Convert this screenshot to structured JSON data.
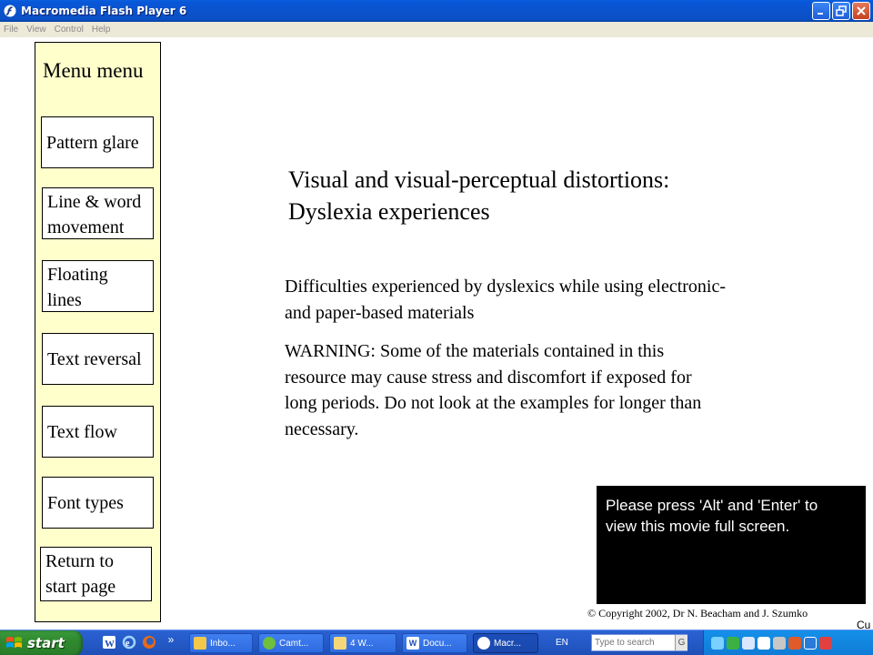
{
  "window": {
    "title": "Macromedia Flash Player 6"
  },
  "menubar": {
    "items": [
      "File",
      "View",
      "Control",
      "Help"
    ]
  },
  "sidebar": {
    "title": "Menu menu",
    "buttons": [
      {
        "line1": "Pattern glare",
        "line2": ""
      },
      {
        "line1": "Line & word",
        "line2": "movement"
      },
      {
        "line1": "Floating",
        "line2": "lines"
      },
      {
        "line1": "Text reversal",
        "line2": ""
      },
      {
        "line1": "Text flow",
        "line2": ""
      },
      {
        "line1": "Font types",
        "line2": ""
      },
      {
        "line1": "Return to",
        "line2": "start page"
      }
    ]
  },
  "main": {
    "heading_line1": "Visual and visual-perceptual distortions:",
    "heading_line2": "Dyslexia experiences",
    "intro_line1": "Difficulties experienced by dyslexics while using electronic-",
    "intro_line2": "and paper-based materials",
    "warning_line1": "WARNING: Some of the materials contained in this",
    "warning_line2": "resource may cause stress and discomfort if exposed for",
    "warning_line3": "long periods. Do not look at the examples for longer than",
    "warning_line4": "necessary."
  },
  "notice": {
    "line1": "Please press 'Alt' and 'Enter' to",
    "line2": "view this movie full screen."
  },
  "footer": {
    "copyright": "© Copyright 2002, Dr N. Beacham and J. Szumko",
    "edge_text": "Cu"
  },
  "taskbar": {
    "start_label": "start",
    "chevron": "»",
    "tasks": [
      {
        "label": "Inbo...",
        "icon": "outlook-icon"
      },
      {
        "label": "Camt...",
        "icon": "camtasia-icon"
      },
      {
        "label": "4 W...",
        "icon": "folder-icon"
      },
      {
        "label": "Docu...",
        "icon": "word-document-icon"
      },
      {
        "label": "Macr...",
        "icon": "flash-player-icon"
      }
    ],
    "language": "EN",
    "search_placeholder": "Type to search",
    "search_go": "G"
  },
  "colors": {
    "sidebar_bg": "#ffffcc",
    "titlebar_blue": "#0a53cc",
    "start_green": "#2f8a2f",
    "notice_bg": "#000000"
  }
}
